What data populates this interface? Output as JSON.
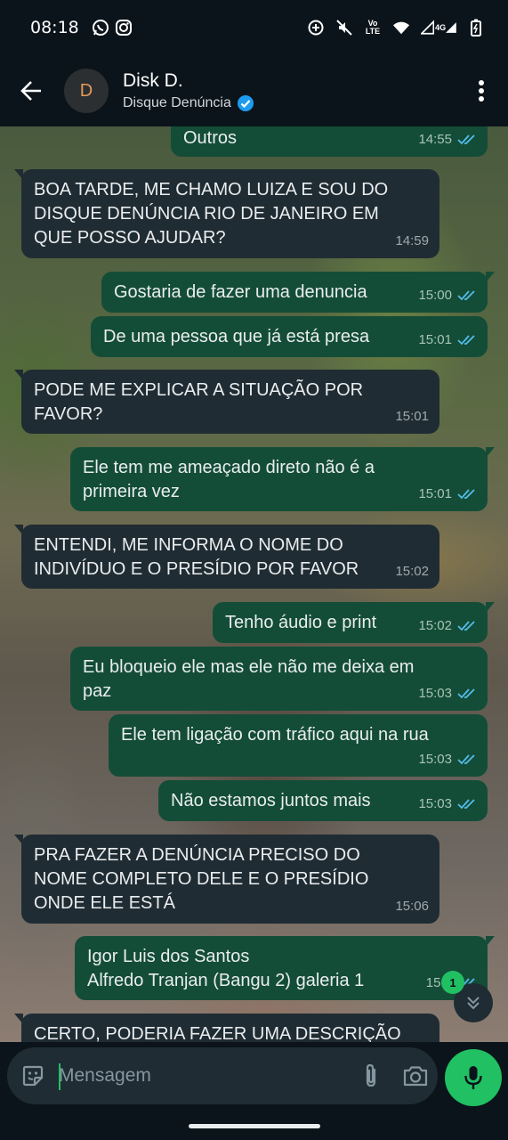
{
  "status_bar": {
    "time": "08:18",
    "left_icons": [
      "whatsapp-icon",
      "instagram-icon"
    ],
    "right_icons": [
      "data-saver-icon",
      "mute-icon",
      "volte-icon",
      "wifi-icon",
      "signal-icon",
      "battery-icon"
    ],
    "volte_label": "Vo\nLTE",
    "network_label": "4G"
  },
  "header": {
    "avatar_letter": "D",
    "contact_name": "Disk D.",
    "subtitle": "Disque Denúncia",
    "verified": true
  },
  "messages": [
    {
      "dir": "out",
      "text": "Outros",
      "time": "14:55",
      "ticks": "read"
    },
    {
      "dir": "in",
      "text": "BOA TARDE, ME CHAMO LUIZA E SOU DO\nDISQUE DENÚNCIA RIO DE JANEIRO EM\nQUE POSSO AJUDAR?",
      "time": "14:59"
    },
    {
      "dir": "out",
      "text": "Gostaria de fazer uma denuncia",
      "time": "15:00",
      "ticks": "read"
    },
    {
      "dir": "out",
      "text": "De uma pessoa que já está presa",
      "time": "15:01",
      "ticks": "read"
    },
    {
      "dir": "in",
      "text": "PODE ME EXPLICAR A SITUAÇÃO POR\nFAVOR?",
      "time": "15:01"
    },
    {
      "dir": "out",
      "text": "Ele tem me ameaçado direto não é a\nprimeira vez",
      "time": "15:01",
      "ticks": "read"
    },
    {
      "dir": "in",
      "text": "ENTENDI, ME INFORMA O NOME DO\nINDIVÍDUO E O PRESÍDIO POR FAVOR",
      "time": "15:02"
    },
    {
      "dir": "out",
      "text": "Tenho áudio e print",
      "time": "15:02",
      "ticks": "read"
    },
    {
      "dir": "out",
      "text": "Eu bloqueio ele mas ele não me deixa em\npaz",
      "time": "15:03",
      "ticks": "read"
    },
    {
      "dir": "out",
      "text": "Ele tem ligação com tráfico aqui na rua",
      "time": "15:03",
      "ticks": "read"
    },
    {
      "dir": "out",
      "text": "Não estamos juntos mais",
      "time": "15:03",
      "ticks": "read"
    },
    {
      "dir": "in",
      "text": "PRA FAZER A DENÚNCIA PRECISO DO\nNOME COMPLETO DELE E O PRESÍDIO\nONDE ELE ESTÁ",
      "time": "15:06"
    },
    {
      "dir": "out",
      "text": "Igor Luis dos Santos\nAlfredo Tranjan (Bangu 2) galeria 1",
      "time": "15:0",
      "ticks": "read"
    },
    {
      "dir": "in",
      "text": "CERTO, PODERIA FAZER UMA DESCRIÇÃO",
      "time": ""
    }
  ],
  "scroll_button": {
    "unread_count": "1"
  },
  "composer": {
    "placeholder": "Mensagem"
  },
  "colors": {
    "outgoing_bubble": "#144d37",
    "incoming_bubble": "#202c33",
    "accent": "#21c063",
    "read_ticks": "#53bdeb"
  }
}
